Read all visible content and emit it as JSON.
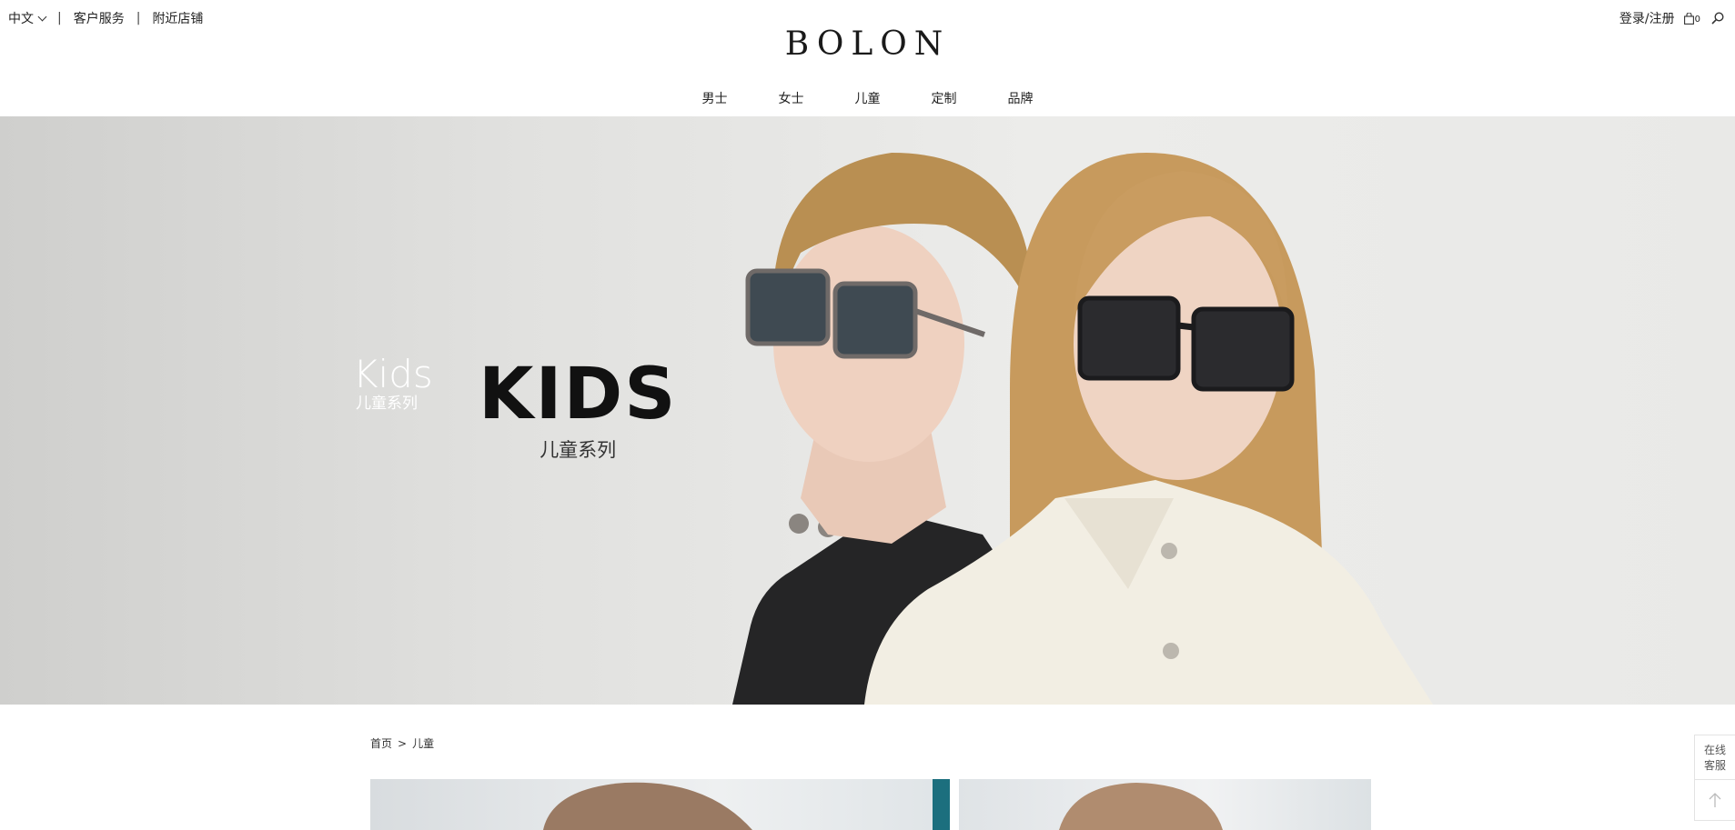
{
  "topbar": {
    "language": "中文",
    "separator": "|",
    "customer_service": "客户服务",
    "nearby_stores": "附近店铺",
    "login_register": "登录/注册",
    "cart_count": "0"
  },
  "brand": {
    "logo_text": "BOLON"
  },
  "nav": {
    "items": [
      "男士",
      "女士",
      "儿童",
      "定制",
      "品牌"
    ]
  },
  "hero": {
    "small_en": "Kids",
    "small_cn": "儿童系列",
    "big_en": "KIDS",
    "big_cn": "儿童系列"
  },
  "breadcrumb": {
    "home": "首页",
    "separator": ">",
    "current": "儿童"
  },
  "side_float": {
    "service_line1": "在线",
    "service_line2": "客服"
  },
  "icons": {
    "cart": "shopping-bag-icon",
    "search": "search-icon",
    "back_to_top": "arrow-up-icon",
    "dropdown": "chevron-down-icon"
  }
}
